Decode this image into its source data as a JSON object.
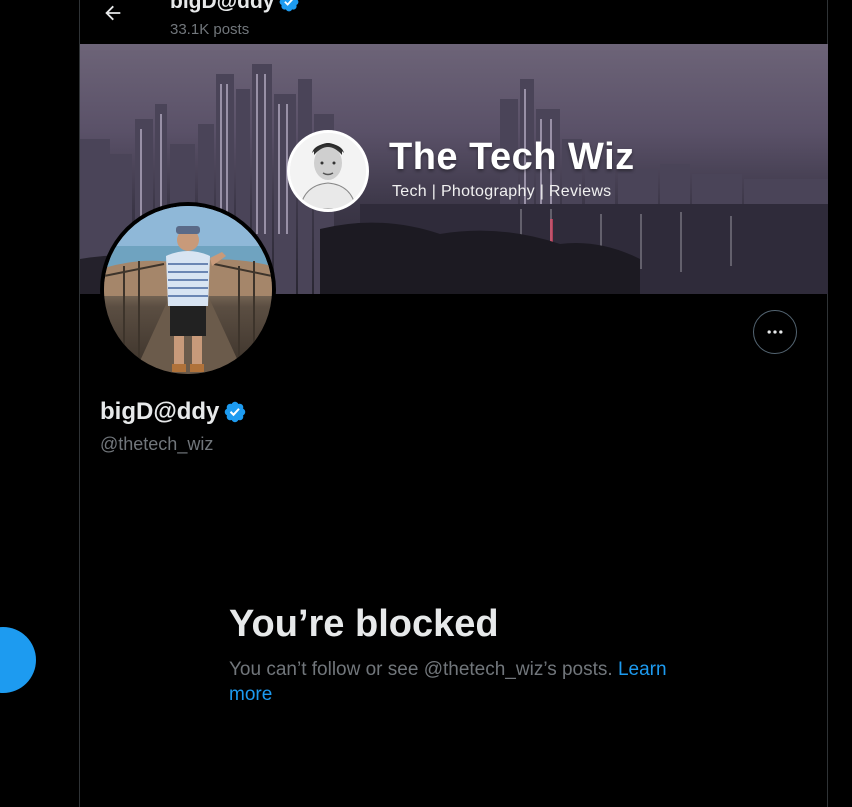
{
  "header": {
    "name": "bigD@ddy",
    "posts": "33.1K posts"
  },
  "banner": {
    "title": "The Tech Wiz",
    "subtitle": "Tech | Photography | Reviews"
  },
  "profile": {
    "display_name": "bigD@ddy",
    "handle": "@thetech_wiz"
  },
  "blocked": {
    "title": "You’re blocked",
    "message": "You can’t follow or see @thetech_wiz’s posts.",
    "link": "Learn more"
  },
  "colors": {
    "accent": "#1d9bf0",
    "background": "#000000",
    "muted": "#71767b"
  },
  "icons": {
    "back": "arrow-left-icon",
    "verified": "verified-badge-icon",
    "more": "more-horizontal-icon"
  }
}
